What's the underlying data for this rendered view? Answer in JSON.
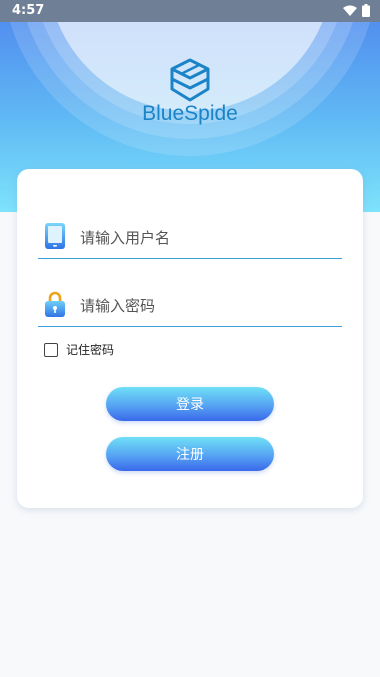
{
  "status_bar": {
    "time": "4:57",
    "icons": [
      "wifi-icon",
      "battery-icon"
    ]
  },
  "app": {
    "brand": "BlueSpide",
    "logo_icon": "cube-logo-icon"
  },
  "login_form": {
    "username": {
      "placeholder": "请输入用户名",
      "value": "",
      "icon": "phone-icon"
    },
    "password": {
      "placeholder": "请输入密码",
      "value": "",
      "icon": "lock-icon"
    },
    "remember": {
      "label": "记住密码",
      "checked": false
    },
    "login_label": "登录",
    "register_label": "注册"
  },
  "colors": {
    "accent": "#1b83c7",
    "hero_top": "#4f86ee",
    "hero_bottom": "#7ee3fb",
    "button_top": "#6fe0f7",
    "button_bottom": "#3a68ea",
    "field_line": "#3f9fd8"
  }
}
